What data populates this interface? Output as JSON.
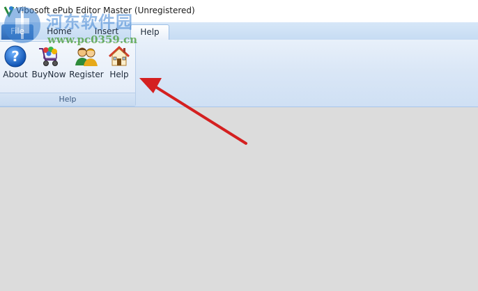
{
  "window": {
    "title": "Vibosoft ePub Editor Master (Unregistered)"
  },
  "tabs": [
    {
      "label": "File"
    },
    {
      "label": "Home"
    },
    {
      "label": "Insert"
    },
    {
      "label": "Help"
    }
  ],
  "ribbon": {
    "group_label": "Help",
    "buttons": [
      {
        "label": "About",
        "icon": "question-icon"
      },
      {
        "label": "BuyNow",
        "icon": "shopping-cart-icon"
      },
      {
        "label": "Register",
        "icon": "users-icon"
      },
      {
        "label": "Help",
        "icon": "home-icon"
      }
    ]
  },
  "watermark": {
    "name": "河东软件园",
    "url": "www.pc0359.cn"
  },
  "colors": {
    "tab_active_file": "#2f6ab7",
    "arrow": "#d42020",
    "workspace": "#dcdcdc"
  }
}
